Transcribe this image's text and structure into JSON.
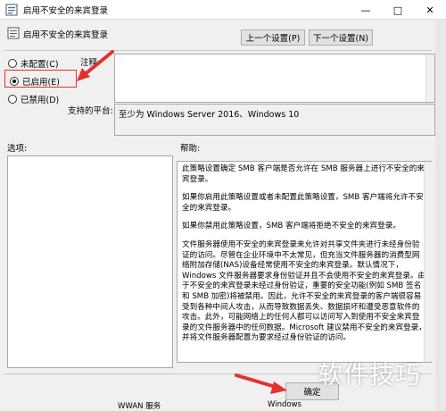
{
  "window": {
    "title": "启用不安全的来宾登录",
    "controls": [
      "—",
      "□",
      "✕"
    ]
  },
  "header": {
    "policy_name": "启用不安全的来宾登录",
    "prev_button": "上一个设置(P)",
    "next_button": "下一个设置(N)"
  },
  "options": {
    "not_configured": "未配置(C)",
    "enabled": "已启用(E)",
    "disabled": "已禁用(D)",
    "selected": "enabled"
  },
  "comment": {
    "label": "注释:",
    "value": ""
  },
  "supported": {
    "label": "支持的平台:",
    "value": "至少为 Windows Server 2016、Windows 10"
  },
  "sections": {
    "options_label": "选项:",
    "help_label": "帮助:"
  },
  "help": {
    "paragraphs": [
      "此策略设置确定 SMB 客户端是否允许在 SMB 服务器上进行不安全的来宾登录。",
      "如果你启用此策略设置或者未配置此策略设置，SMB 客户端将允许不安全的来宾登录。",
      "如果你禁用此策略设置，SMB 客户端将拒绝不安全的来宾登录。",
      "文件服务器使用不安全的来宾登录来允许对共享文件夹进行未经身份验证的访问。尽管在企业环境中不太常见，但充当文件服务器的消费型网络附加存储(NAS)设备经常使用不安全的来宾登录。默认情况下，Windows 文件服务器要求身份验证并且不会使用不安全的来宾登录。由于不安全的来宾登录未经过身份验证，重要的安全功能(例如 SMB 签名和 SMB 加密)将被禁用。因此，允许不安全的来宾登录的客户端很容易受到各种中间人攻击，从而导致数据丢失、数据损坏和遭受恶意软件的攻击。此外，可能网络上的任何人都可以访问写入到使用不安全来宾登录的文件服务器中的任何数据。Microsoft 建议禁用不安全的来宾登录，并将文件服务器配置为要求经过身份验证的访问。"
    ]
  },
  "footer": {
    "ok_button": "确定",
    "taskbar_item_1": "WWAN 服务",
    "taskbar_item_2": "Windows"
  },
  "watermark": "软件技巧",
  "colors": {
    "annotation_red": "#e53030"
  }
}
